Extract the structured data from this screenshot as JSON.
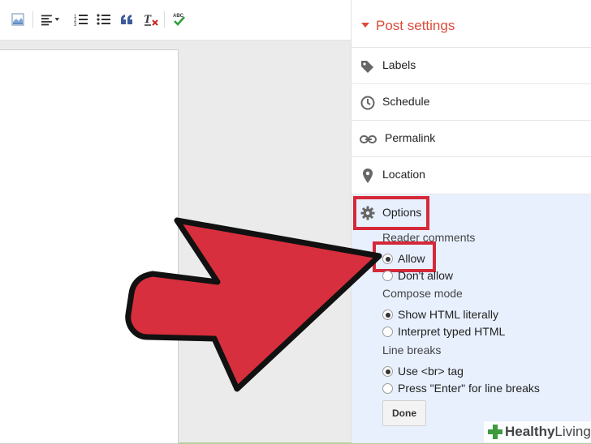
{
  "toolbar": {
    "icons": [
      "image-icon",
      "align-icon",
      "numbered-list-icon",
      "bulleted-list-icon",
      "quote-icon",
      "clear-format-icon",
      "spellcheck-icon"
    ]
  },
  "sidebar": {
    "title": "Post settings",
    "items": [
      {
        "label": "Labels",
        "icon": "tag-icon"
      },
      {
        "label": "Schedule",
        "icon": "clock-icon"
      },
      {
        "label": "Permalink",
        "icon": "link-icon"
      },
      {
        "label": "Location",
        "icon": "location-pin-icon"
      }
    ],
    "options": {
      "title": "Options",
      "reader_comments_label": "Reader comments",
      "reader_comments": [
        {
          "label": "Allow",
          "selected": true
        },
        {
          "label": "Don't allow",
          "selected": false
        }
      ],
      "compose_mode_label": "Compose mode",
      "compose_mode": [
        {
          "label": "Show HTML literally",
          "selected": true
        },
        {
          "label": "Interpret typed HTML",
          "selected": false
        }
      ],
      "line_breaks_label": "Line breaks",
      "line_breaks": [
        {
          "label": "Use <br> tag",
          "selected": true
        },
        {
          "label": "Press \"Enter\" for line breaks",
          "selected": false
        }
      ],
      "done_label": "Done"
    }
  },
  "watermark": {
    "brand_bold": "Healthy",
    "brand_regular": "Living"
  },
  "colors": {
    "accent": "#dd4b39",
    "highlight": "#d5293a",
    "options_bg": "#e8f0fe",
    "frame": "#b9cf9d"
  }
}
